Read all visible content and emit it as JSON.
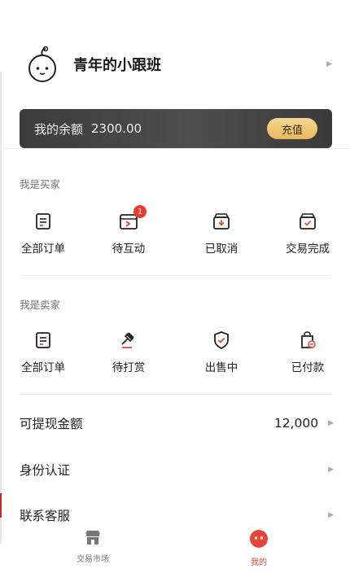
{
  "profile": {
    "name": "青年的小跟班",
    "avatar_icon": "baby-face-icon",
    "chevron_icon": "chevron-right-icon"
  },
  "balance": {
    "label": "我的余额",
    "value": "2300.00",
    "recharge_label": "充值"
  },
  "buyer": {
    "title": "我是买家",
    "items": [
      {
        "label": "全部订单",
        "icon": "order-list-icon"
      },
      {
        "label": "待互动",
        "icon": "interaction-icon",
        "badge": "1"
      },
      {
        "label": "已取消",
        "icon": "cancelled-box-icon"
      },
      {
        "label": "交易完成",
        "icon": "completed-box-icon"
      }
    ]
  },
  "seller": {
    "title": "我是卖家",
    "items": [
      {
        "label": "全部订单",
        "icon": "order-list-icon"
      },
      {
        "label": "待打赏",
        "icon": "gavel-icon"
      },
      {
        "label": "出售中",
        "icon": "shield-check-icon"
      },
      {
        "label": "已付款",
        "icon": "bag-paid-icon"
      }
    ]
  },
  "menu": [
    {
      "label": "可提现金额",
      "value": "12,000"
    },
    {
      "label": "身份认证"
    },
    {
      "label": "联系客服"
    }
  ],
  "tabbar": {
    "tabs": [
      {
        "label": "交易市场",
        "icon": "store-icon",
        "active": false
      },
      {
        "label": "我的",
        "icon": "smile-face-icon",
        "active": true
      }
    ]
  },
  "colors": {
    "accent": "#e8443a",
    "badge": "#e83a2f",
    "gold": "#e8b95a",
    "card": "#444444"
  }
}
